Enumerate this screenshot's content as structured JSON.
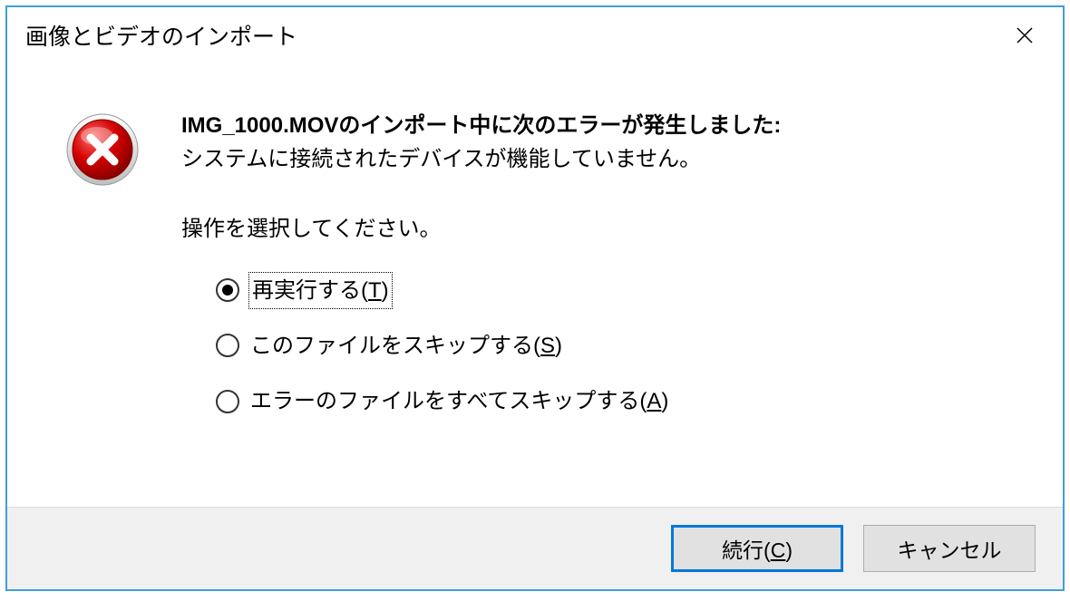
{
  "dialog": {
    "title": "画像とビデオのインポート",
    "filename": "IMG_1000.MOV",
    "msg_after_filename": "のインポート中に次のエラーが発生しました:",
    "msg_line2": "システムに接続されたデバイスが機能していません。",
    "prompt": "操作を選択してください。",
    "options": [
      {
        "label_pre": "再実行する(",
        "key": "T",
        "label_post": ")",
        "checked": true,
        "focused": true
      },
      {
        "label_pre": "このファイルをスキップする(",
        "key": "S",
        "label_post": ")",
        "checked": false,
        "focused": false
      },
      {
        "label_pre": "エラーのファイルをすべてスキップする(",
        "key": "A",
        "label_post": ")",
        "checked": false,
        "focused": false
      }
    ],
    "buttons": {
      "continue_pre": "続行(",
      "continue_key": "C",
      "continue_post": ")",
      "cancel": "キャンセル"
    }
  }
}
